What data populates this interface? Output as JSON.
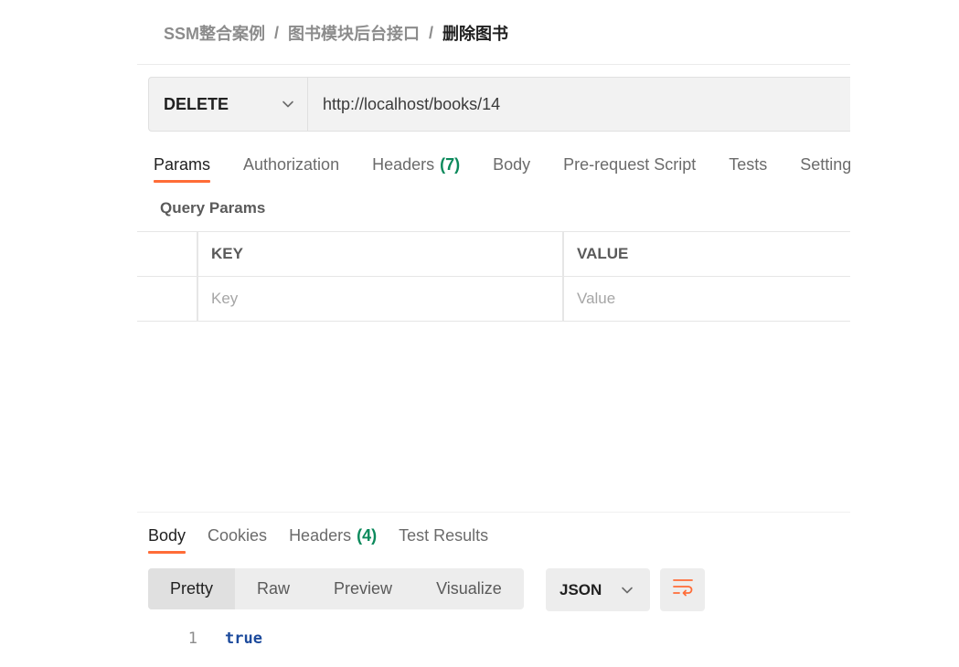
{
  "breadcrumb": {
    "items": [
      "SSM整合案例",
      "图书模块后台接口",
      "删除图书"
    ],
    "separator": "/"
  },
  "request": {
    "method": "DELETE",
    "url": "http://localhost/books/14"
  },
  "request_tabs": [
    {
      "label": "Params",
      "count": ""
    },
    {
      "label": "Authorization",
      "count": ""
    },
    {
      "label": "Headers",
      "count": "(7)"
    },
    {
      "label": "Body",
      "count": ""
    },
    {
      "label": "Pre-request Script",
      "count": ""
    },
    {
      "label": "Tests",
      "count": ""
    },
    {
      "label": "Settings",
      "count": ""
    }
  ],
  "query_params": {
    "title": "Query Params",
    "columns": {
      "key": "KEY",
      "value": "VALUE"
    },
    "placeholders": {
      "key": "Key",
      "value": "Value"
    }
  },
  "response_tabs": [
    {
      "label": "Body",
      "count": ""
    },
    {
      "label": "Cookies",
      "count": ""
    },
    {
      "label": "Headers",
      "count": "(4)"
    },
    {
      "label": "Test Results",
      "count": ""
    }
  ],
  "response_toolbar": {
    "formats": [
      "Pretty",
      "Raw",
      "Preview",
      "Visualize"
    ],
    "active_format": "Pretty",
    "language": "JSON"
  },
  "response_body": {
    "lines": [
      {
        "number": "1",
        "text": "true"
      }
    ]
  },
  "colors": {
    "accent": "#ff6c37",
    "count_green": "#0c8a5c",
    "code_value": "#1c4a9c"
  },
  "icons": {
    "method_dropdown": "chevron-down-icon",
    "language_dropdown": "chevron-down-icon",
    "wrap_lines": "wrap-lines-icon"
  }
}
